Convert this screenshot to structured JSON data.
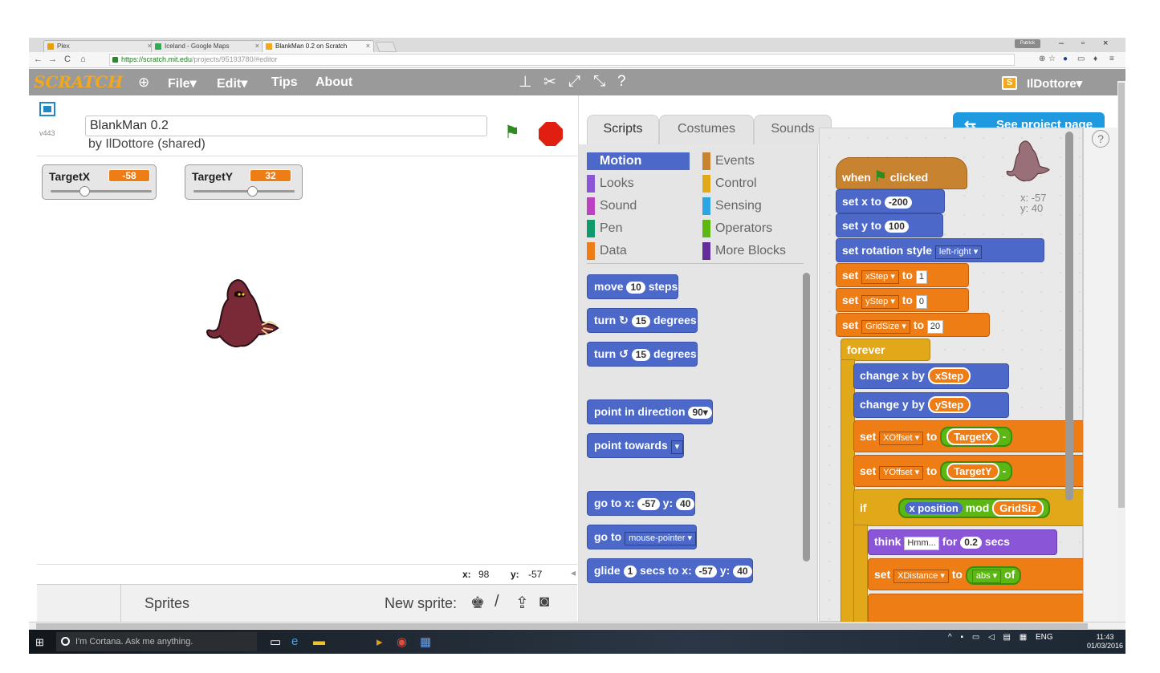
{
  "browser": {
    "tabs": [
      {
        "label": "Plex",
        "color": "#e5a00d"
      },
      {
        "label": "Iceland - Google Maps",
        "color": "#34a853"
      },
      {
        "label": "BlankMan 0.2 on Scratch",
        "color": "#f2a81c"
      }
    ],
    "profile": "Patrick",
    "url_scheme": "https://",
    "url_host": "scratch.mit.edu",
    "url_path": "/projects/95193780/#editor"
  },
  "menubar": {
    "logo": "SCRATCH",
    "file": "File▾",
    "edit": "Edit▾",
    "tips": "Tips",
    "about": "About",
    "username": "IlDottore▾"
  },
  "stage": {
    "version": "v443",
    "project_title": "BlankMan 0.2",
    "byline": "by IlDottore (shared)",
    "monitors": [
      {
        "label": "TargetX",
        "value": "-58",
        "slider_fraction": 0.33
      },
      {
        "label": "TargetY",
        "value": "32",
        "slider_fraction": 0.58
      }
    ],
    "mouse_x_label": "x:",
    "mouse_x": "98",
    "mouse_y_label": "y:",
    "mouse_y": "-57"
  },
  "sprites": {
    "label": "Sprites",
    "new_sprite": "New sprite:"
  },
  "panel": {
    "tabs": [
      "Scripts",
      "Costumes",
      "Sounds"
    ],
    "see_project": "See project page",
    "categories_left": [
      {
        "label": "Motion",
        "color": "#4c69c9"
      },
      {
        "label": "Looks",
        "color": "#8a55d7"
      },
      {
        "label": "Sound",
        "color": "#bb42c3"
      },
      {
        "label": "Pen",
        "color": "#0e9a6c"
      },
      {
        "label": "Data",
        "color": "#ee7d16"
      }
    ],
    "categories_right": [
      {
        "label": "Events",
        "color": "#c88330"
      },
      {
        "label": "Control",
        "color": "#e1a91a"
      },
      {
        "label": "Sensing",
        "color": "#2ca5e2"
      },
      {
        "label": "Operators",
        "color": "#5cb712"
      },
      {
        "label": "More Blocks",
        "color": "#632d99"
      }
    ],
    "palette_blocks": {
      "move": "move",
      "move_n": "10",
      "move_steps": "steps",
      "turn_r": "turn ↻",
      "turn_r_n": "15",
      "turn_r_deg": "degrees",
      "turn_l": "turn ↺",
      "turn_l_n": "15",
      "turn_l_deg": "degrees",
      "point_dir": "point in direction",
      "point_dir_n": "90▾",
      "point_towards": "point towards",
      "goto_xy": "go to x:",
      "goto_x": "-57",
      "goto_y_label": "y:",
      "goto_y": "40",
      "goto": "go to",
      "goto_target": "mouse-pointer",
      "glide": "glide",
      "glide_n": "1",
      "glide_mid": "secs to x:",
      "glide_x": "-57",
      "glide_y_label": "y:",
      "glide_y": "40"
    }
  },
  "script": {
    "sprite_x": "x: -57",
    "sprite_y": "y: 40",
    "when": "when",
    "clicked": "clicked",
    "setx": "set x to",
    "setx_v": "-200",
    "sety": "set y to",
    "sety_v": "100",
    "rot": "set rotation style",
    "rot_v": "left-right",
    "set": "set",
    "to": "to",
    "v1": "xStep",
    "v1_val": "1",
    "v2": "yStep",
    "v2_val": "0",
    "v3": "GridSize",
    "v3_val": "20",
    "forever": "forever",
    "chx": "change x by",
    "chx_v": "xStep",
    "chy": "change y by",
    "chy_v": "yStep",
    "xoff": "XOffset",
    "xoff_v": "TargetX",
    "yoff": "YOffset",
    "yoff_v": "TargetY",
    "minus": "-",
    "if": "if",
    "xpos": "x position",
    "mod": "mod",
    "gridsiz": "GridSiz",
    "think": "think",
    "think_v": "Hmm...",
    "think_for": "for",
    "think_n": "0.2",
    "think_secs": "secs",
    "xdist": "XDistance",
    "abs": "abs",
    "of": "of"
  },
  "taskbar": {
    "cortana": "I'm Cortana. Ask me anything.",
    "lang": "ENG",
    "time": "11:43",
    "date": "01/03/2016"
  }
}
